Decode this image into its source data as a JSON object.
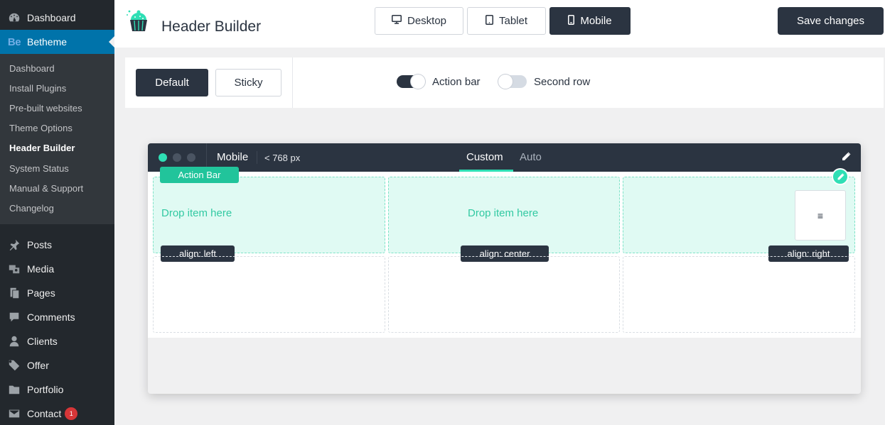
{
  "sidebar": {
    "dashboard": "Dashboard",
    "betheme": "Betheme",
    "betheme_logo": "Be",
    "submenu": [
      {
        "label": "Dashboard"
      },
      {
        "label": "Install Plugins"
      },
      {
        "label": "Pre-built websites"
      },
      {
        "label": "Theme Options"
      },
      {
        "label": "Header Builder",
        "active": true
      },
      {
        "label": "System Status"
      },
      {
        "label": "Manual & Support"
      },
      {
        "label": "Changelog"
      }
    ],
    "menu": [
      {
        "label": "Posts",
        "icon": "pin-icon"
      },
      {
        "label": "Media",
        "icon": "media-icon"
      },
      {
        "label": "Pages",
        "icon": "pages-icon"
      },
      {
        "label": "Comments",
        "icon": "comment-icon"
      },
      {
        "label": "Clients",
        "icon": "user-icon"
      },
      {
        "label": "Offer",
        "icon": "tag-icon"
      },
      {
        "label": "Portfolio",
        "icon": "folder-icon"
      },
      {
        "label": "Contact",
        "icon": "mail-icon",
        "badge": "1"
      }
    ]
  },
  "header": {
    "title": "Header Builder",
    "devices": {
      "desktop": "Desktop",
      "tablet": "Tablet",
      "mobile": "Mobile",
      "active": "mobile"
    },
    "save_label": "Save changes"
  },
  "options": {
    "default_label": "Default",
    "sticky_label": "Sticky",
    "action_bar_label": "Action bar",
    "action_bar_on": true,
    "second_row_label": "Second row",
    "second_row_on": false
  },
  "builder": {
    "device_title": "Mobile",
    "breakpoint": "< 768 px",
    "tab_custom": "Custom",
    "tab_auto": "Auto",
    "row_label": "Action Bar",
    "drop_left": "Drop item here",
    "drop_center": "Drop item here",
    "align_left": "align: left",
    "align_center": "align: center",
    "align_right": "align: right",
    "menu_glyph": "≡"
  },
  "colors": {
    "accent": "#2fdfb5",
    "dark": "#2b3441",
    "wp_blue": "#0073aa",
    "wp_sidebar": "#23282d"
  }
}
